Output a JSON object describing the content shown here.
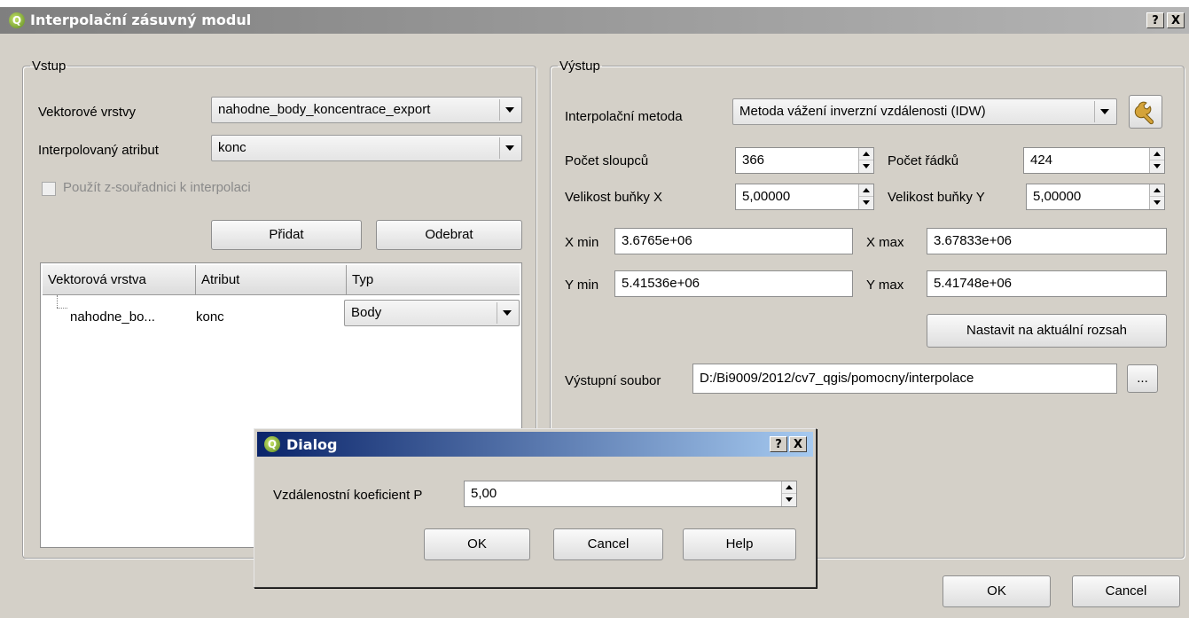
{
  "window": {
    "title": "Interpolační zásuvný modul",
    "help_button": "?",
    "close_button": "X"
  },
  "input": {
    "legend": "Vstup",
    "vector_layers_label": "Vektorové vrstvy",
    "vector_layers_value": "nahodne_body_koncentrace_export",
    "interp_attr_label": "Interpolovaný atribut",
    "interp_attr_value": "konc",
    "use_z_label": "Použít z-souřadnici k interpolaci",
    "use_z_checked": false,
    "add_button": "Přidat",
    "remove_button": "Odebrat",
    "table": {
      "headers": [
        "Vektorová vrstva",
        "Atribut",
        "Typ"
      ],
      "rows": [
        {
          "layer": "nahodne_bo...",
          "attribute": "konc",
          "type": "Body"
        }
      ]
    }
  },
  "output": {
    "legend": "Výstup",
    "method_label": "Interpolační metoda",
    "method_value": "Metoda vážení inverzní vzdálenosti (IDW)",
    "cols_label": "Počet sloupců",
    "cols_value": "366",
    "rows_label": "Počet řádků",
    "rows_value": "424",
    "cellx_label": "Velikost buňky X",
    "cellx_value": "5,00000",
    "celly_label": "Velikost buňky Y",
    "celly_value": "5,00000",
    "xmin_label": "X min",
    "xmin_value": "3.6765e+06",
    "xmax_label": "X max",
    "xmax_value": "3.67833e+06",
    "ymin_label": "Y min",
    "ymin_value": "5.41536e+06",
    "ymax_label": "Y max",
    "ymax_value": "5.41748e+06",
    "set_extent_button": "Nastavit na aktuální rozsah",
    "output_file_label": "Výstupní soubor",
    "output_file_value": "D:/Bi9009/2012/cv7_qgis/pomocny/interpolace",
    "browse_button": "..."
  },
  "main_buttons": {
    "ok": "OK",
    "cancel": "Cancel"
  },
  "dialog": {
    "title": "Dialog",
    "help_button": "?",
    "close_button": "X",
    "coef_label": "Vzdálenostní koeficient P",
    "coef_value": "5,00",
    "ok": "OK",
    "cancel": "Cancel",
    "help": "Help"
  },
  "icons": {
    "app": "qgis-icon",
    "settings": "wrench-icon"
  }
}
